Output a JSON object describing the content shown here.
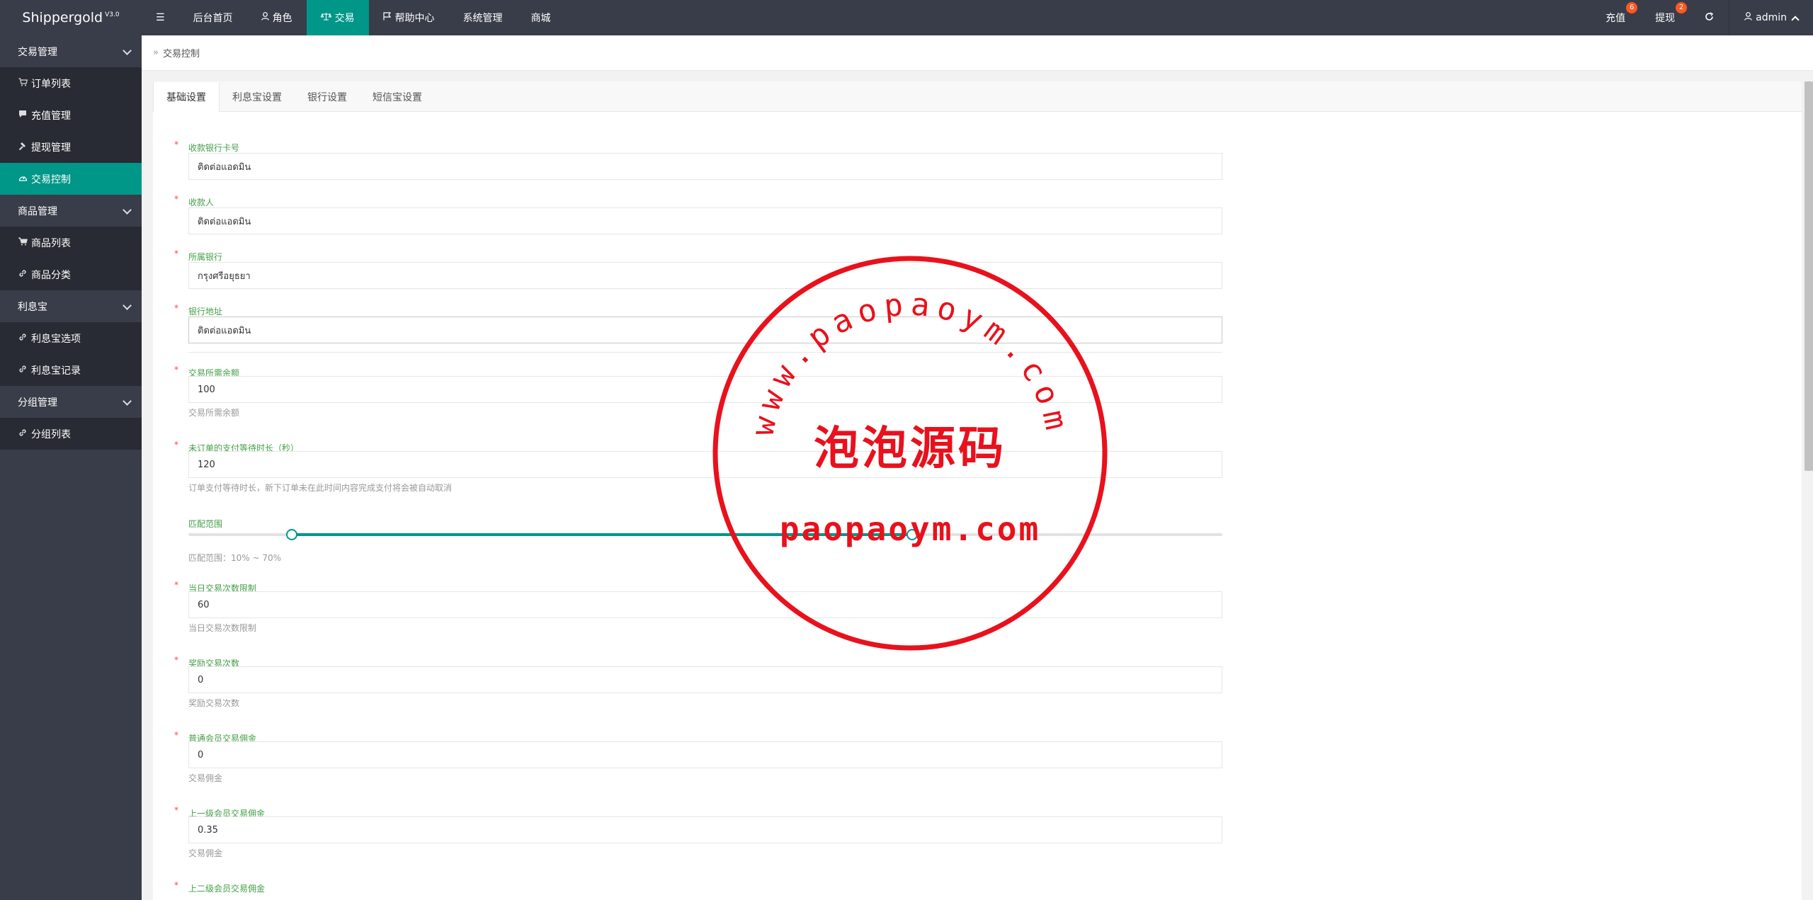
{
  "brand": {
    "name": "Shippergold",
    "version": "V3.0"
  },
  "topnav": [
    {
      "label": "☰",
      "icon": "menu-icon",
      "active": false
    },
    {
      "label": "后台首页",
      "active": false
    },
    {
      "label": "角色",
      "icon": "user-icon",
      "active": false
    },
    {
      "label": "交易",
      "icon": "scale-icon",
      "active": true
    },
    {
      "label": "帮助中心",
      "icon": "flag-icon",
      "active": false
    },
    {
      "label": "系统管理",
      "active": false
    },
    {
      "label": "商城",
      "active": false
    }
  ],
  "topright": {
    "recharge": {
      "label": "充值",
      "badge": "6"
    },
    "withdraw": {
      "label": "提现",
      "badge": "2"
    },
    "refresh_icon": "refresh-icon",
    "user": {
      "label": "admin"
    }
  },
  "sidebar": [
    {
      "type": "group",
      "label": "交易管理"
    },
    {
      "type": "item",
      "label": "订单列表",
      "icon": "cart-icon",
      "glyph": "🛒"
    },
    {
      "type": "item",
      "label": "充值管理",
      "icon": "chat-icon",
      "glyph": "▀"
    },
    {
      "type": "item",
      "label": "提现管理",
      "icon": "hammer-icon",
      "glyph": "✎"
    },
    {
      "type": "item",
      "label": "交易控制",
      "icon": "dashboard-icon",
      "glyph": "◔",
      "active": true
    },
    {
      "type": "group",
      "label": "商品管理"
    },
    {
      "type": "item",
      "label": "商品列表",
      "icon": "cart-icon",
      "glyph": "🛒"
    },
    {
      "type": "item",
      "label": "商品分类",
      "icon": "link-icon",
      "glyph": "🔗"
    },
    {
      "type": "group",
      "label": "利息宝"
    },
    {
      "type": "item",
      "label": "利息宝选项",
      "icon": "link-icon",
      "glyph": "🔗"
    },
    {
      "type": "item",
      "label": "利息宝记录",
      "icon": "link-icon",
      "glyph": "🔗"
    },
    {
      "type": "group",
      "label": "分组管理"
    },
    {
      "type": "item",
      "label": "分组列表",
      "icon": "link-icon",
      "glyph": "🔗"
    }
  ],
  "breadcrumb": {
    "label": "交易控制"
  },
  "tabs": [
    "基础设置",
    "利息宝设置",
    "银行设置",
    "短信宝设置"
  ],
  "fields": {
    "bank_card": {
      "label": "收款银行卡号",
      "value": "ติดต่อแอดมิน"
    },
    "payee": {
      "label": "收款人",
      "value": "ติดต่อแอดมิน"
    },
    "bank": {
      "label": "所属银行",
      "value": "กรุงศรีอยุธยา"
    },
    "bank_address": {
      "label": "银行地址",
      "value": "ติดต่อแอดมิน"
    },
    "min_balance": {
      "label": "交易所需余额",
      "value": "100",
      "hint": "交易所需余额"
    },
    "pay_wait": {
      "label": "未订单的支付等待时长（秒）",
      "value": "120",
      "hint": "订单支付等待时长，新下订单未在此时间内容完成支付将会被自动取消"
    },
    "match_range": {
      "label": "匹配范围",
      "hint": "匹配范围：10% ~ 70%",
      "min_pct": 10,
      "max_pct": 70
    },
    "daily_limit": {
      "label": "当日交易次数限制",
      "value": "60",
      "hint": "当日交易次数限制"
    },
    "reward_times": {
      "label": "奖励交易次数",
      "value": "0",
      "hint": "奖励交易次数"
    },
    "normal_commission": {
      "label": "普通会员交易佣金",
      "value": "0",
      "hint": "交易佣金"
    },
    "level1_commission": {
      "label": "上一级会员交易佣金",
      "value": "0.35",
      "hint": "交易佣金"
    },
    "level2_commission": {
      "label": "上二级会员交易佣金"
    }
  },
  "stamp": {
    "top_text": "www.paopaoym.com",
    "center_text": "泡泡源码",
    "bottom_text": "paopaoym.com",
    "color": "#e8111c"
  },
  "colors": {
    "accent": "#009688",
    "dark": "#393d49",
    "badge": "#ff5722"
  }
}
